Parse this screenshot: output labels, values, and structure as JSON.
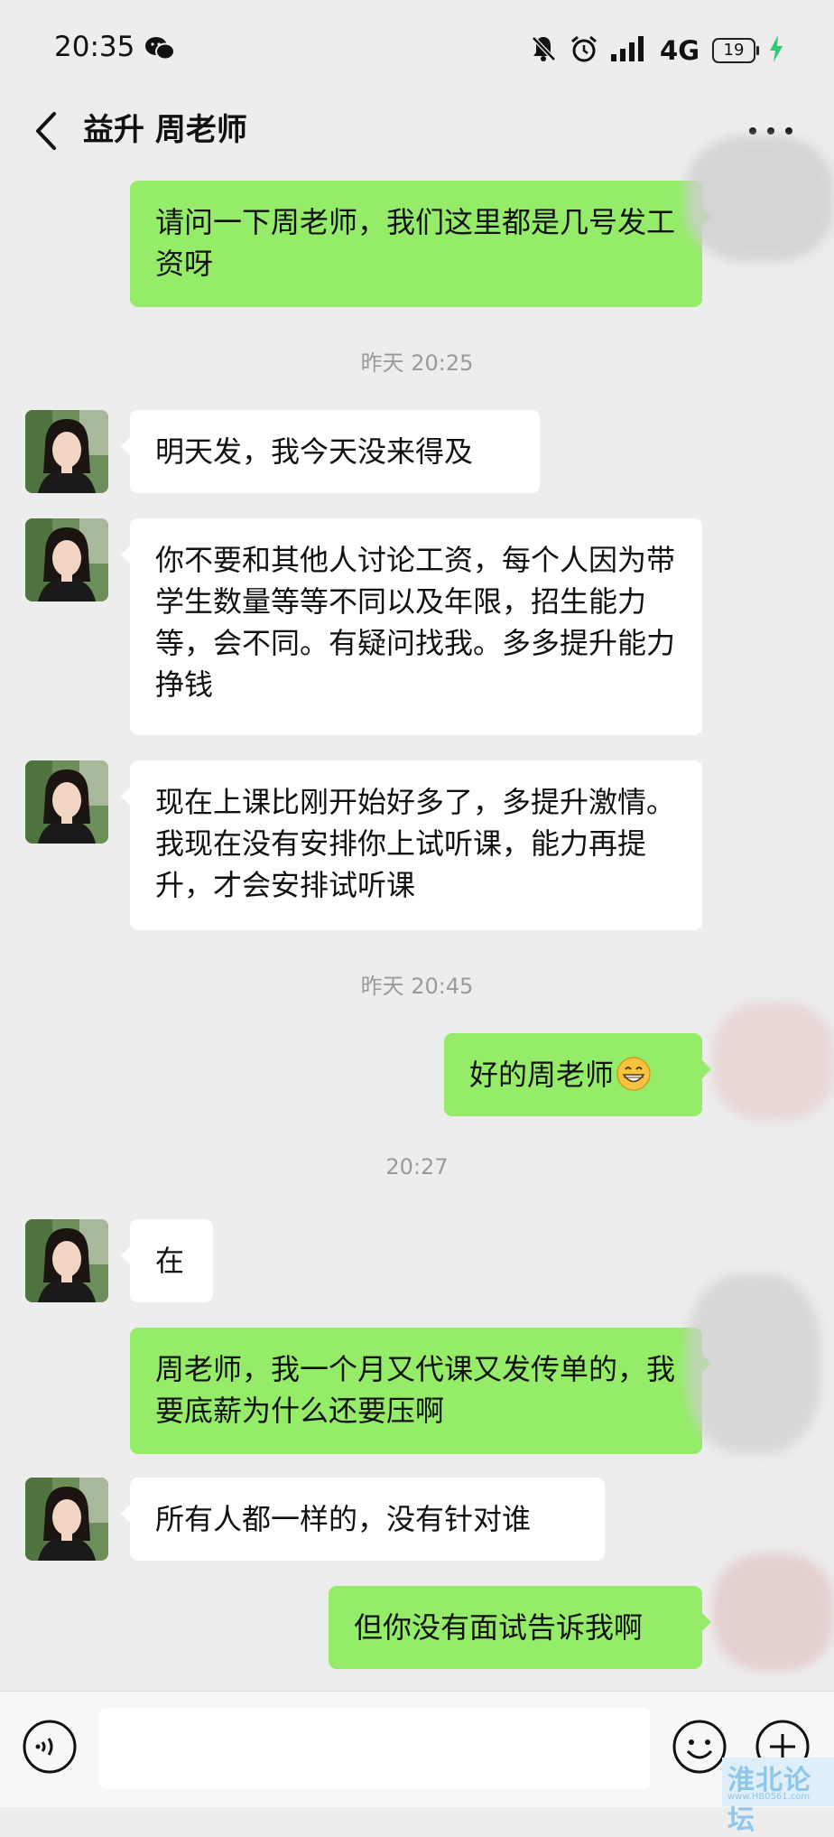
{
  "status_bar": {
    "time": "20:35",
    "network": "4G",
    "battery": "19"
  },
  "header": {
    "title": "益升 周老师"
  },
  "messages": [
    {
      "side": "out",
      "text": "请问一下周老师，我们这里都是几号发工资呀"
    },
    {
      "type": "time",
      "text": "昨天 20:25"
    },
    {
      "side": "in",
      "text": "明天发，我今天没来得及"
    },
    {
      "side": "in",
      "text": "你不要和其他人讨论工资，每个人因为带学生数量等等不同以及年限，招生能力等，会不同。有疑问找我。多多提升能力挣钱"
    },
    {
      "side": "in",
      "text": "现在上课比刚开始好多了，多提升激情。我现在没有安排你上试听课，能力再提升，才会安排试听课"
    },
    {
      "type": "time",
      "text": "昨天 20:45"
    },
    {
      "side": "out",
      "text": "好的周老师",
      "emoji": "grin-emoji"
    },
    {
      "type": "time",
      "text": "20:27"
    },
    {
      "side": "in",
      "text": "在"
    },
    {
      "side": "out",
      "text": "周老师，我一个月又代课又发传单的，我要底薪为什么还要压啊"
    },
    {
      "side": "in",
      "text": "所有人都一样的，没有针对谁"
    },
    {
      "side": "out",
      "text": "但你没有面试告诉我啊"
    }
  ],
  "watermark": {
    "name": "淮北论坛",
    "url": "www.HB0561.com"
  },
  "colors": {
    "out_bubble": "#95ec69",
    "in_bubble": "#ffffff",
    "background": "#ededed"
  }
}
